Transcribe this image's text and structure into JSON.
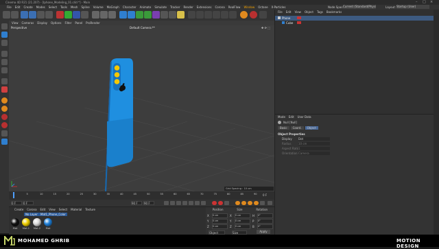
{
  "window": {
    "title": "Cinema 4D R21 (21.207) - [Iphone_Modeling_01.c4d *] - Main"
  },
  "main_menu": [
    "File",
    "Edit",
    "Create",
    "Modes",
    "Select",
    "Tools",
    "Mesh",
    "Spline",
    "Volume",
    "MoGraph",
    "Character",
    "Animate",
    "Simulate",
    "Tracker",
    "Render",
    "Extensions",
    "Corona",
    "RealFlow",
    "Window",
    "Octane",
    "X-Particles"
  ],
  "node_space": {
    "label": "Node Space:",
    "value": "Current (Standard/Physical)"
  },
  "layout": {
    "label": "Layout:",
    "value": "Startup (User)"
  },
  "viewport": {
    "menu": [
      "View",
      "Cameras",
      "Display",
      "Options",
      "Filter",
      "Panel",
      "ProRender"
    ],
    "name": "Perspective",
    "camera": "Default Camera:**",
    "grid_spacing": "Grid Spacing : 10 cm"
  },
  "timeline": {
    "ticks": [
      "0",
      "5",
      "10",
      "15",
      "20",
      "25",
      "30",
      "35",
      "40",
      "45",
      "50",
      "55",
      "60",
      "65",
      "70",
      "75",
      "80",
      "85",
      "90"
    ],
    "end_frame": "0 F",
    "start": "0 F",
    "current": "0 F",
    "max": "90 F",
    "max2": "90 F"
  },
  "material_manager": {
    "menu": [
      "Create",
      "Corona",
      "Edit",
      "View",
      "Select",
      "Material",
      "Texture"
    ],
    "layers": [
      "No Layer",
      "Mat1_Phone_Color"
    ],
    "materials": [
      {
        "name": "Mat",
        "color": "#111111"
      },
      {
        "name": "Mat.1",
        "color": "#f0d000"
      },
      {
        "name": "Mat.2",
        "color": "#d8d8d8"
      },
      {
        "name": "Mat",
        "color": "#1e7fd8"
      }
    ]
  },
  "coords": {
    "headers": [
      "Position",
      "Size",
      "Rotation"
    ],
    "rows": [
      {
        "a": "X",
        "av": "0 cm",
        "b": "X",
        "bv": "0 cm",
        "c": "H",
        "cv": "0°"
      },
      {
        "a": "Y",
        "av": "0 cm",
        "b": "Y",
        "bv": "0 cm",
        "c": "P",
        "cv": "0°"
      },
      {
        "a": "Z",
        "av": "0 cm",
        "b": "Z",
        "bv": "0 cm",
        "c": "B",
        "cv": "0°"
      }
    ],
    "mode": "Object (Rel)",
    "size_mode": "Size",
    "apply": "Apply"
  },
  "object_manager": {
    "menu": [
      "File",
      "Edit",
      "View",
      "Object",
      "Tags",
      "Bookmarks"
    ],
    "objects": [
      "Phone",
      "Cube"
    ]
  },
  "attribute_manager": {
    "menu": [
      "Mode",
      "Edit",
      "User Data"
    ],
    "title": "Null [Null]",
    "tabs": [
      "Basic",
      "Coord.",
      "Object"
    ],
    "section": "Object Properties",
    "props": [
      {
        "label": "Display",
        "value": "Dot"
      },
      {
        "label": "Radius",
        "value": "10 cm"
      },
      {
        "label": "Aspect Ratio",
        "value": "1"
      },
      {
        "label": "Orientation",
        "value": "Camera"
      }
    ]
  },
  "footer": {
    "author": "MOHAMED GHRIB",
    "brand": "MOTION DESIGN"
  },
  "colors": {
    "accent": "#f0a000",
    "phone_blue": "#1f8fe0",
    "yellow_icon": "#f5c800"
  }
}
